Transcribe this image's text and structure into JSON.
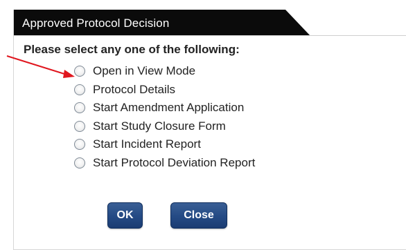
{
  "dialog": {
    "title": "Approved Protocol Decision",
    "instruction": "Please select any one of the following:",
    "options": [
      {
        "label": "Open in View Mode",
        "selected": false
      },
      {
        "label": "Protocol Details",
        "selected": false
      },
      {
        "label": "Start Amendment Application",
        "selected": false
      },
      {
        "label": "Start Study Closure Form",
        "selected": false
      },
      {
        "label": "Start Incident Report",
        "selected": false
      },
      {
        "label": "Start Protocol Deviation Report",
        "selected": false
      }
    ],
    "buttons": {
      "ok_label": "OK",
      "close_label": "Close"
    }
  },
  "annotation": {
    "arrow_color": "#e0161e"
  },
  "colors": {
    "title_bar": "#0b0b0b",
    "button": "#244a84"
  }
}
